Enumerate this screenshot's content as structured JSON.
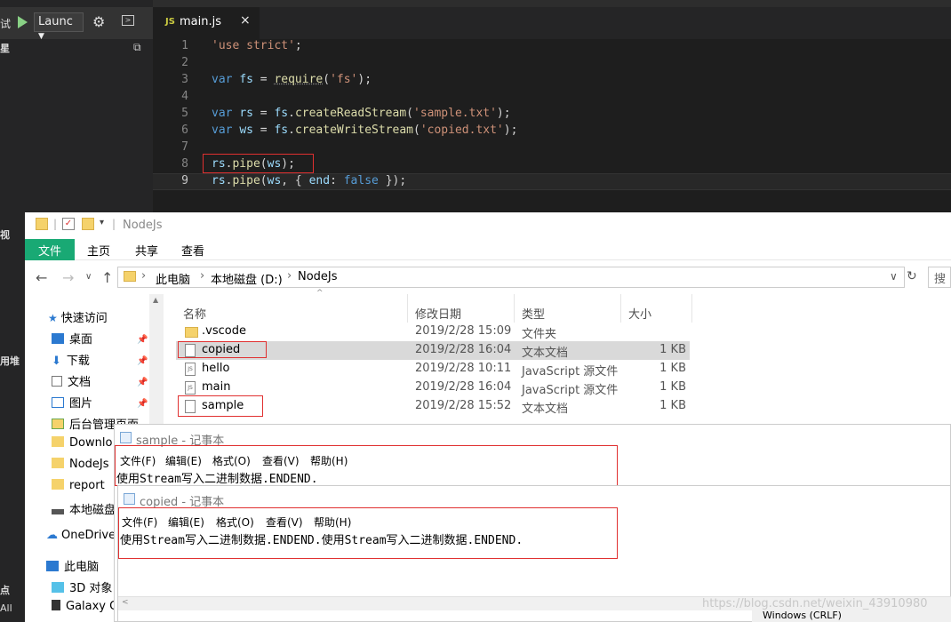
{
  "vscode": {
    "debug_label": "试",
    "launch_config": "Launc",
    "side_heads": [
      "星",
      "视",
      "用堆",
      "点",
      "All"
    ],
    "tab": {
      "icon": "JS",
      "name": "main.js",
      "close": "×"
    },
    "lines": [
      "1",
      "2",
      "3",
      "4",
      "5",
      "6",
      "7",
      "8",
      "9"
    ]
  },
  "explorer": {
    "title": "NodeJs",
    "ribbon": [
      "文件",
      "主页",
      "共享",
      "查看"
    ],
    "breadcrumb": [
      "此电脑",
      "本地磁盘 (D:)",
      "NodeJs"
    ],
    "search_placeholder": "搜",
    "nav": [
      {
        "label": "快速访问",
        "icon": "star-icon"
      },
      {
        "label": "桌面",
        "icon": "desktop-icon",
        "pinned": true
      },
      {
        "label": "下载",
        "icon": "download-icon",
        "pinned": true
      },
      {
        "label": "文档",
        "icon": "document-icon",
        "pinned": true
      },
      {
        "label": "图片",
        "icon": "picture-icon",
        "pinned": true
      },
      {
        "label": "后台管理页面",
        "icon": "folder-icon",
        "pinned": true
      },
      {
        "label": "Downlo",
        "icon": "folder-icon"
      },
      {
        "label": "NodeJs",
        "icon": "folder-icon"
      },
      {
        "label": "report",
        "icon": "folder-icon"
      },
      {
        "label": "本地磁盘",
        "icon": "drive-icon"
      },
      {
        "label": "OneDrive",
        "icon": "cloud-icon"
      },
      {
        "label": "此电脑",
        "icon": "computer-icon"
      },
      {
        "label": "3D 对象",
        "icon": "cube-icon"
      },
      {
        "label": "Galaxy C",
        "icon": "phone-icon"
      }
    ],
    "columns": [
      "名称",
      "修改日期",
      "类型",
      "大小"
    ],
    "files": [
      {
        "name": ".vscode",
        "date": "2019/2/28 15:09",
        "type": "文件夹",
        "size": "",
        "icon": "folder"
      },
      {
        "name": "copied",
        "date": "2019/2/28 16:04",
        "type": "文本文档",
        "size": "1 KB",
        "icon": "txt"
      },
      {
        "name": "hello",
        "date": "2019/2/28 10:11",
        "type": "JavaScript 源文件",
        "size": "1 KB",
        "icon": "js"
      },
      {
        "name": "main",
        "date": "2019/2/28 16:04",
        "type": "JavaScript 源文件",
        "size": "1 KB",
        "icon": "js"
      },
      {
        "name": "sample",
        "date": "2019/2/28 15:52",
        "type": "文本文档",
        "size": "1 KB",
        "icon": "txt"
      }
    ]
  },
  "notepad_sample": {
    "title": "sample - 记事本",
    "menu": [
      "文件(F)",
      "编辑(E)",
      "格式(O)",
      "查看(V)",
      "帮助(H)"
    ],
    "content": "使用Stream写入二进制数据.ENDEND."
  },
  "notepad_copied": {
    "title": "copied - 记事本",
    "menu": [
      "文件(F)",
      "编辑(E)",
      "格式(O)",
      "查看(V)",
      "帮助(H)"
    ],
    "content": "使用Stream写入二进制数据.ENDEND.使用Stream写入二进制数据.ENDEND."
  },
  "status": "Windows (CRLF)",
  "watermark": "https://blog.csdn.net/weixin_43910980"
}
